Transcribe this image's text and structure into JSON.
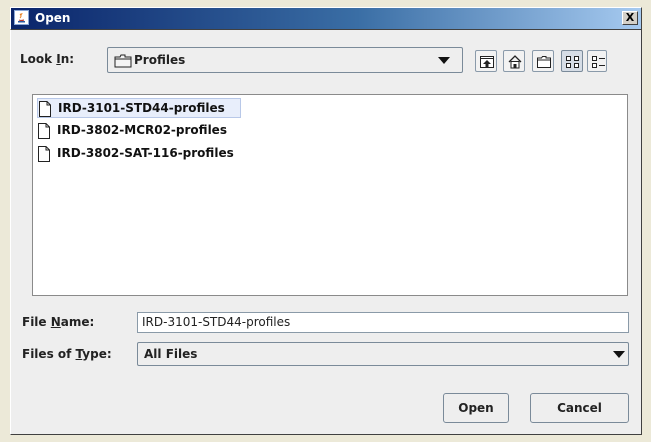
{
  "window": {
    "title": "Open",
    "close_glyph": "X"
  },
  "look_in": {
    "label_pre": "Look ",
    "label_mnemonic": "I",
    "label_post": "n:",
    "value": "Profiles",
    "icon": "folder-icon"
  },
  "toolbar": {
    "buttons": [
      {
        "name": "up-one-level",
        "icon": "up-folder-icon"
      },
      {
        "name": "home",
        "icon": "home-icon"
      },
      {
        "name": "create-new-folder",
        "icon": "new-folder-icon"
      },
      {
        "name": "list-view",
        "icon": "list-view-icon",
        "active": true
      },
      {
        "name": "details-view",
        "icon": "details-view-icon",
        "active": false
      }
    ]
  },
  "files": [
    {
      "name": "IRD-3101-STD44-profiles",
      "selected": true,
      "icon": "file-icon"
    },
    {
      "name": "IRD-3802-MCR02-profiles",
      "selected": false,
      "icon": "file-icon"
    },
    {
      "name": "IRD-3802-SAT-116-profiles",
      "selected": false,
      "icon": "file-icon"
    }
  ],
  "file_name": {
    "label_pre": "File ",
    "label_mnemonic": "N",
    "label_post": "ame:",
    "value": "IRD-3101-STD44-profiles"
  },
  "file_type": {
    "label_pre": "Files of ",
    "label_mnemonic": "T",
    "label_post": "ype:",
    "value": "All Files"
  },
  "buttons": {
    "open": "Open",
    "cancel": "Cancel"
  },
  "colors": {
    "title_bar": "#0a246a",
    "dialog_bg": "#eeeeee",
    "selection": "#e8eefb"
  }
}
